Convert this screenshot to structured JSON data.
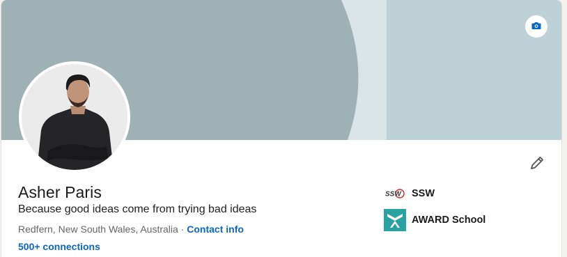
{
  "profile": {
    "name": "Asher Paris",
    "headline": "Because good ideas come from trying bad ideas",
    "location": "Redfern, New South Wales, Australia",
    "separator": " · ",
    "contact_label": "Contact info",
    "connections_label": "500+ connections"
  },
  "organizations": [
    {
      "label": "SSW",
      "logo_text": "SSW",
      "icon": "ssw-logo"
    },
    {
      "label": "AWARD School",
      "icon": "award-school-logo"
    }
  ],
  "icons": {
    "banner_edit": "camera-icon",
    "profile_edit": "pencil-icon"
  },
  "colors": {
    "link": "#0a66c2",
    "banner_dark": "#a0b1b6",
    "banner_light": "#dbe4e6",
    "banner_mid": "#bed1d6",
    "award_teal": "#2aa3a0"
  }
}
